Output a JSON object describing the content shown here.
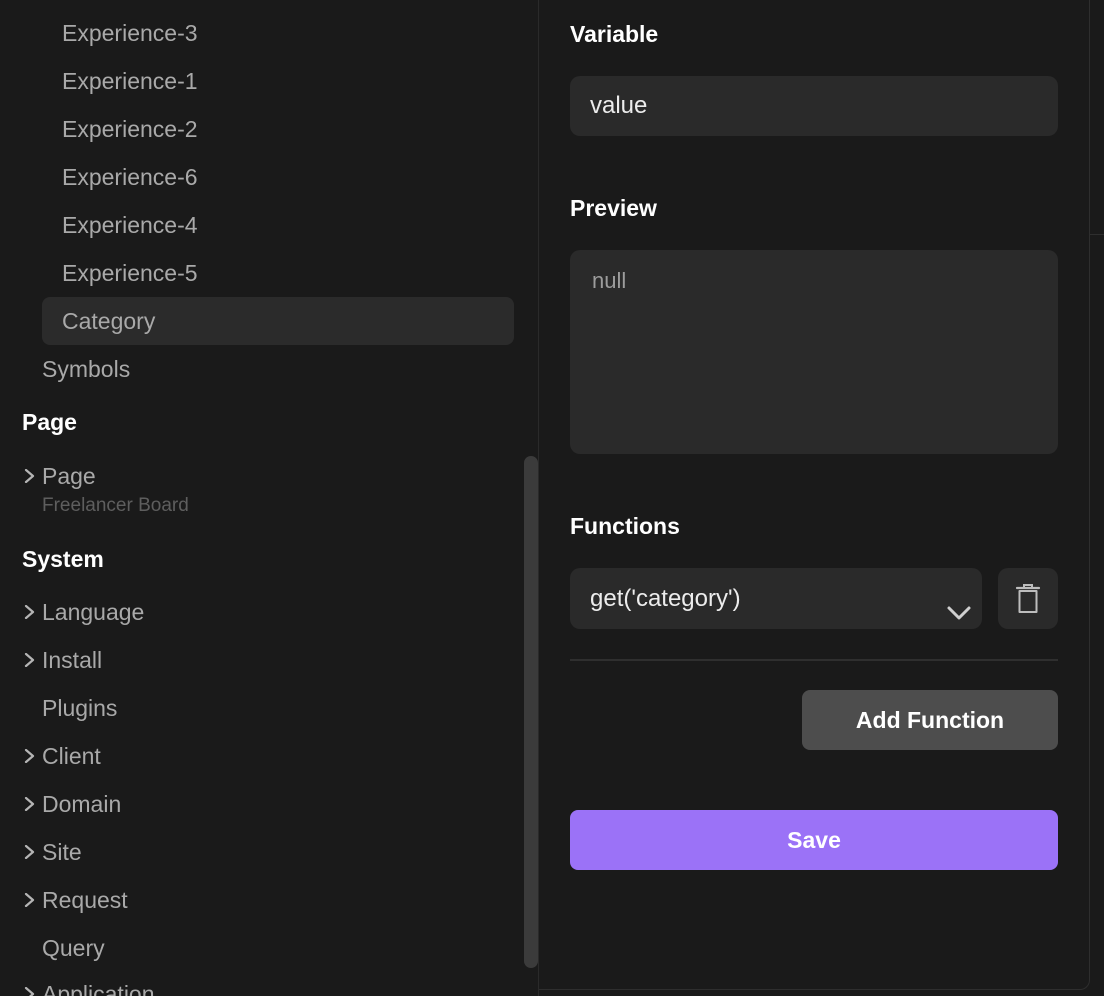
{
  "tree": {
    "children": [
      {
        "label": "Experience-3"
      },
      {
        "label": "Experience-1"
      },
      {
        "label": "Experience-2"
      },
      {
        "label": "Experience-6"
      },
      {
        "label": "Experience-4"
      },
      {
        "label": "Experience-5"
      },
      {
        "label": "Category",
        "selected": true
      }
    ],
    "symbols_label": "Symbols"
  },
  "page_section": {
    "heading": "Page",
    "page_item": "Page",
    "page_caption": "Freelancer Board"
  },
  "system_section": {
    "heading": "System",
    "items": [
      {
        "label": "Language",
        "expandable": true
      },
      {
        "label": "Install",
        "expandable": true
      },
      {
        "label": "Plugins",
        "expandable": false
      },
      {
        "label": "Client",
        "expandable": true
      },
      {
        "label": "Domain",
        "expandable": true
      },
      {
        "label": "Site",
        "expandable": true
      },
      {
        "label": "Request",
        "expandable": true
      },
      {
        "label": "Query",
        "expandable": false
      },
      {
        "label": "Application",
        "expandable": true
      }
    ]
  },
  "panel": {
    "variable_label": "Variable",
    "variable_value": "value",
    "preview_label": "Preview",
    "preview_value": "null",
    "functions_label": "Functions",
    "function_selected": "get('category')",
    "add_function_label": "Add Function",
    "save_label": "Save"
  },
  "colors": {
    "background": "#1a1a1a",
    "field": "#2a2a2a",
    "accent": "#9b72f7",
    "secondary_button": "#4d4d4d"
  },
  "icons": {
    "chevron": "chevron-right-icon",
    "caret": "chevron-down-icon",
    "delete": "trash-icon"
  }
}
